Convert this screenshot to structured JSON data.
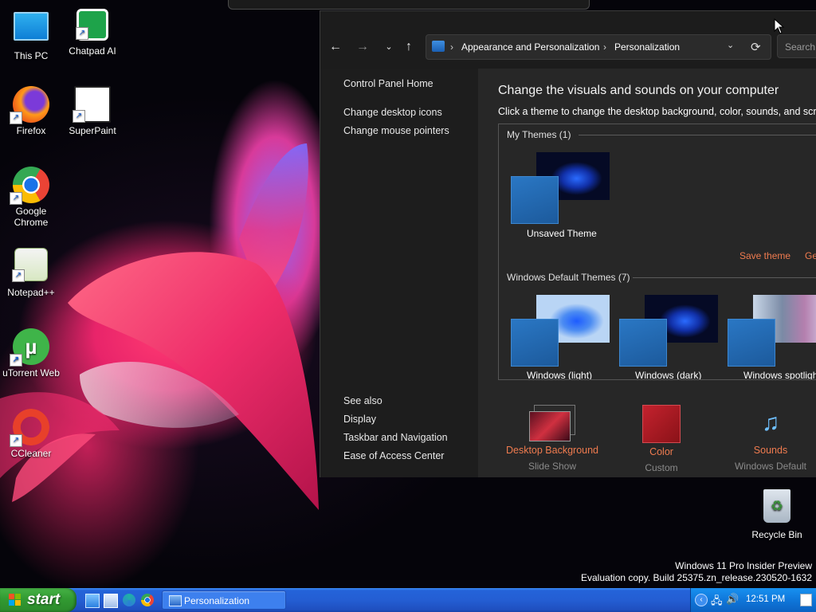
{
  "desktop": {
    "icons": [
      {
        "label": "This PC",
        "icon": "monitor-icon"
      },
      {
        "label": "Chatpad AI",
        "icon": "chatpad-icon"
      },
      {
        "label": "Firefox",
        "icon": "firefox-icon"
      },
      {
        "label": "SuperPaint",
        "icon": "superpaint-icon"
      },
      {
        "label": "Google Chrome",
        "icon": "chrome-icon"
      },
      {
        "label": "Notepad++",
        "icon": "notepadpp-icon"
      },
      {
        "label": "uTorrent Web",
        "icon": "utorrent-icon"
      },
      {
        "label": "CCleaner",
        "icon": "ccleaner-icon"
      },
      {
        "label": "Recycle Bin",
        "icon": "recycle-bin-icon"
      }
    ],
    "watermark": {
      "line1": "Windows 11 Pro Insider Preview",
      "line2": "Evaluation copy. Build 25375.zn_release.230520-1632"
    }
  },
  "window": {
    "breadcrumb": [
      "Appearance and Personalization",
      "Personalization"
    ],
    "search_placeholder": "Search",
    "sidebar": {
      "top_links": [
        "Control Panel Home",
        "Change desktop icons",
        "Change mouse pointers"
      ],
      "see_also_title": "See also",
      "see_also_links": [
        "Display",
        "Taskbar and Navigation",
        "Ease of Access Center"
      ]
    },
    "main": {
      "title": "Change the visuals and sounds on your computer",
      "subtitle": "Click a theme to change the desktop background, color, sounds, and screen",
      "my_themes_header": "My Themes (1)",
      "unsaved_theme_label": "Unsaved Theme",
      "save_theme": "Save theme",
      "get_more": "Ge",
      "default_themes_header": "Windows Default Themes (7)",
      "default_theme_labels": [
        "Windows (light)",
        "Windows (dark)",
        "Windows spotlight"
      ],
      "bottom": [
        {
          "label": "Desktop Background",
          "sub": "Slide Show",
          "icon": "desktop-background-icon"
        },
        {
          "label": "Color",
          "sub": "Custom",
          "icon": "color-icon"
        },
        {
          "label": "Sounds",
          "sub": "Windows Default",
          "icon": "sounds-icon"
        }
      ]
    }
  },
  "taskbar": {
    "start_label": "start",
    "task_label": "Personalization",
    "clock": "12:51 PM"
  },
  "colors": {
    "accent_link": "#ef7b4f",
    "taskbar_blue": "#245ed3",
    "start_green": "#329a32"
  }
}
